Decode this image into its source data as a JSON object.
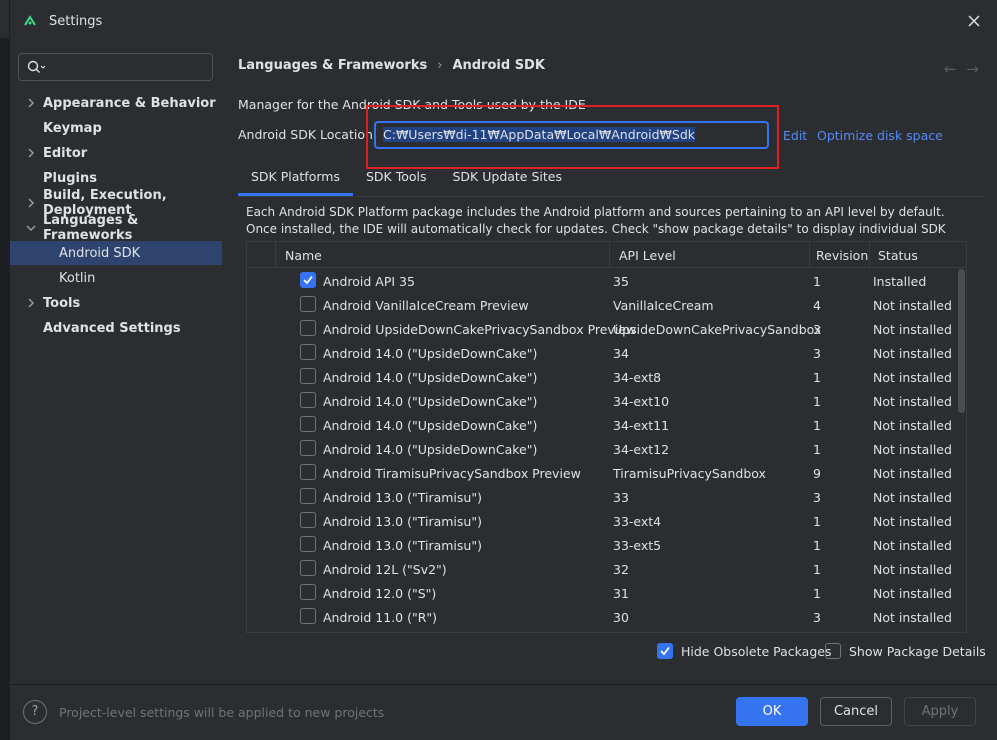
{
  "window": {
    "title": "Settings"
  },
  "sidebar": {
    "search_placeholder": "",
    "items": [
      {
        "label": "Appearance & Behavior",
        "expandable": true,
        "expanded": false
      },
      {
        "label": "Keymap",
        "expandable": false
      },
      {
        "label": "Editor",
        "expandable": true,
        "expanded": false
      },
      {
        "label": "Plugins",
        "expandable": false
      },
      {
        "label": "Build, Execution, Deployment",
        "expandable": true,
        "expanded": false
      },
      {
        "label": "Languages & Frameworks",
        "expandable": true,
        "expanded": true
      },
      {
        "label": "Android SDK",
        "child": true,
        "selected": true
      },
      {
        "label": "Kotlin",
        "child": true
      },
      {
        "label": "Tools",
        "expandable": true,
        "expanded": false
      },
      {
        "label": "Advanced Settings",
        "expandable": false
      }
    ]
  },
  "breadcrumb": {
    "parent": "Languages & Frameworks",
    "separator": "›",
    "current": "Android SDK"
  },
  "nav": {
    "back": "←",
    "forward": "→"
  },
  "main": {
    "description": "Manager for the Android SDK and Tools used by the IDE",
    "location_label": "Android SDK Location:",
    "location_value": "C:₩Users₩di-11₩AppData₩Local₩Android₩Sdk",
    "edit_link": "Edit",
    "optimize_link": "Optimize disk space",
    "tabs": [
      "SDK Platforms",
      "SDK Tools",
      "SDK Update Sites"
    ],
    "active_tab": 0,
    "info": "Each Android SDK Platform package includes the Android platform and sources pertaining to an API level by default. Once installed, the IDE will automatically check for updates. Check \"show package details\" to display individual SDK components."
  },
  "table": {
    "headers": {
      "name": "Name",
      "api": "API Level",
      "revision": "Revision",
      "status": "Status"
    },
    "rows": [
      {
        "checked": true,
        "name": "Android API 35",
        "api": "35",
        "revision": "1",
        "status": "Installed"
      },
      {
        "checked": false,
        "name": "Android VanillaIceCream Preview",
        "api": "VanillaIceCream",
        "revision": "4",
        "status": "Not installed"
      },
      {
        "checked": false,
        "name": "Android UpsideDownCakePrivacySandbox Preview",
        "api": "UpsideDownCakePrivacySandbox",
        "revision": "3",
        "status": "Not installed"
      },
      {
        "checked": false,
        "name": "Android 14.0 (\"UpsideDownCake\")",
        "api": "34",
        "revision": "3",
        "status": "Not installed"
      },
      {
        "checked": false,
        "name": "Android 14.0 (\"UpsideDownCake\")",
        "api": "34-ext8",
        "revision": "1",
        "status": "Not installed"
      },
      {
        "checked": false,
        "name": "Android 14.0 (\"UpsideDownCake\")",
        "api": "34-ext10",
        "revision": "1",
        "status": "Not installed"
      },
      {
        "checked": false,
        "name": "Android 14.0 (\"UpsideDownCake\")",
        "api": "34-ext11",
        "revision": "1",
        "status": "Not installed"
      },
      {
        "checked": false,
        "name": "Android 14.0 (\"UpsideDownCake\")",
        "api": "34-ext12",
        "revision": "1",
        "status": "Not installed"
      },
      {
        "checked": false,
        "name": "Android TiramisuPrivacySandbox Preview",
        "api": "TiramisuPrivacySandbox",
        "revision": "9",
        "status": "Not installed"
      },
      {
        "checked": false,
        "name": "Android 13.0 (\"Tiramisu\")",
        "api": "33",
        "revision": "3",
        "status": "Not installed"
      },
      {
        "checked": false,
        "name": "Android 13.0 (\"Tiramisu\")",
        "api": "33-ext4",
        "revision": "1",
        "status": "Not installed"
      },
      {
        "checked": false,
        "name": "Android 13.0 (\"Tiramisu\")",
        "api": "33-ext5",
        "revision": "1",
        "status": "Not installed"
      },
      {
        "checked": false,
        "name": "Android 12L (\"Sv2\")",
        "api": "32",
        "revision": "1",
        "status": "Not installed"
      },
      {
        "checked": false,
        "name": "Android 12.0 (\"S\")",
        "api": "31",
        "revision": "1",
        "status": "Not installed"
      },
      {
        "checked": false,
        "name": "Android 11.0 (\"R\")",
        "api": "30",
        "revision": "3",
        "status": "Not installed"
      }
    ]
  },
  "options": {
    "hide_obsolete": {
      "label": "Hide Obsolete Packages",
      "checked": true
    },
    "show_details": {
      "label": "Show Package Details",
      "checked": false
    }
  },
  "footer": {
    "help": "?",
    "note": "Project-level settings will be applied to new projects",
    "ok": "OK",
    "cancel": "Cancel",
    "apply": "Apply"
  },
  "colors": {
    "accent": "#3574f0",
    "link": "#548af7",
    "highlight": "#e02020",
    "selection": "#2e436e"
  }
}
